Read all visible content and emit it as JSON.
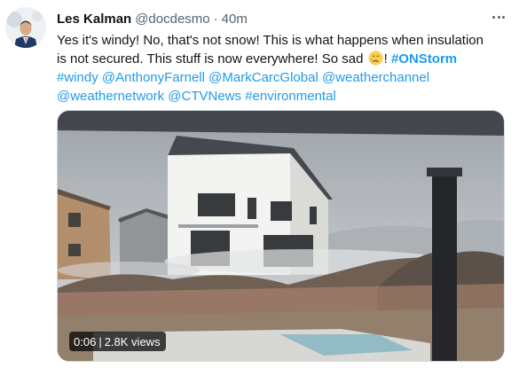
{
  "author": {
    "name": "Les Kalman",
    "handle": "@docdesmo",
    "separator": "·",
    "time": "40m"
  },
  "tweet": {
    "line1": "Yes it's windy!  No, that's not snow!  This is what happens when insulation",
    "line2": "is not secured.  This stuff is now everywhere! So sad",
    "line2_after_emoji": "!",
    "emoji": "crying-face-icon",
    "hashtag_onstorm": "#ONStorm",
    "line3_tags": [
      "#windy",
      "@AnthonyFarnell",
      "@MarkCarcGlobal",
      "@weatherchannel"
    ],
    "line4_tags": [
      "@weathernetwork",
      "@CTVNews",
      "#environmental"
    ]
  },
  "video": {
    "duration": "0:06",
    "views": "2.8K views",
    "separator": "|"
  },
  "icons": {
    "more": "more-horizontal-icon",
    "avatar": "avatar-photo"
  },
  "colors": {
    "link": "#1d9bf0",
    "secondary_text": "#536471",
    "primary_text": "#0f1419"
  }
}
